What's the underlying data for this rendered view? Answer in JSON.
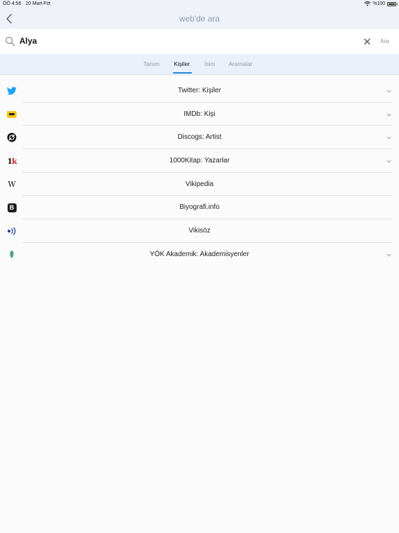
{
  "status_bar": {
    "time": "ÖÖ 4:56",
    "date": "20 Mart Pzt",
    "battery": "%100"
  },
  "nav": {
    "title": "web'de ara"
  },
  "search": {
    "query": "Alya",
    "submit_label": "Ara"
  },
  "tabs": [
    {
      "label": "Tanım",
      "active": false
    },
    {
      "label": "Kişiler",
      "active": true
    },
    {
      "label": "İsim",
      "active": false
    },
    {
      "label": "Aramalar",
      "active": false
    }
  ],
  "results": [
    {
      "label": "Twitter: Kişiler",
      "icon": "twitter-icon",
      "expandable": true
    },
    {
      "label": "IMDb: Kişi",
      "icon": "imdb-icon",
      "expandable": true
    },
    {
      "label": "Discogs: Artist",
      "icon": "discogs-icon",
      "expandable": true
    },
    {
      "label": "1000Kitap: Yazarlar",
      "icon": "1000kitap-icon",
      "expandable": true
    },
    {
      "label": "Vikipedia",
      "icon": "wikipedia-icon",
      "expandable": false
    },
    {
      "label": "Biyografi.info",
      "icon": "biyografi-icon",
      "expandable": false
    },
    {
      "label": "Vikisöz",
      "icon": "vikisoz-icon",
      "expandable": false
    },
    {
      "label": "YÖK Akademik: Akademisyenler",
      "icon": "yok-icon",
      "expandable": true
    }
  ],
  "colors": {
    "accent": "#1e88d7",
    "bar_background": "#eef2f8",
    "tab_background": "#e9f0fa",
    "twitter": "#1da1f2",
    "imdb": "#f5c518"
  }
}
